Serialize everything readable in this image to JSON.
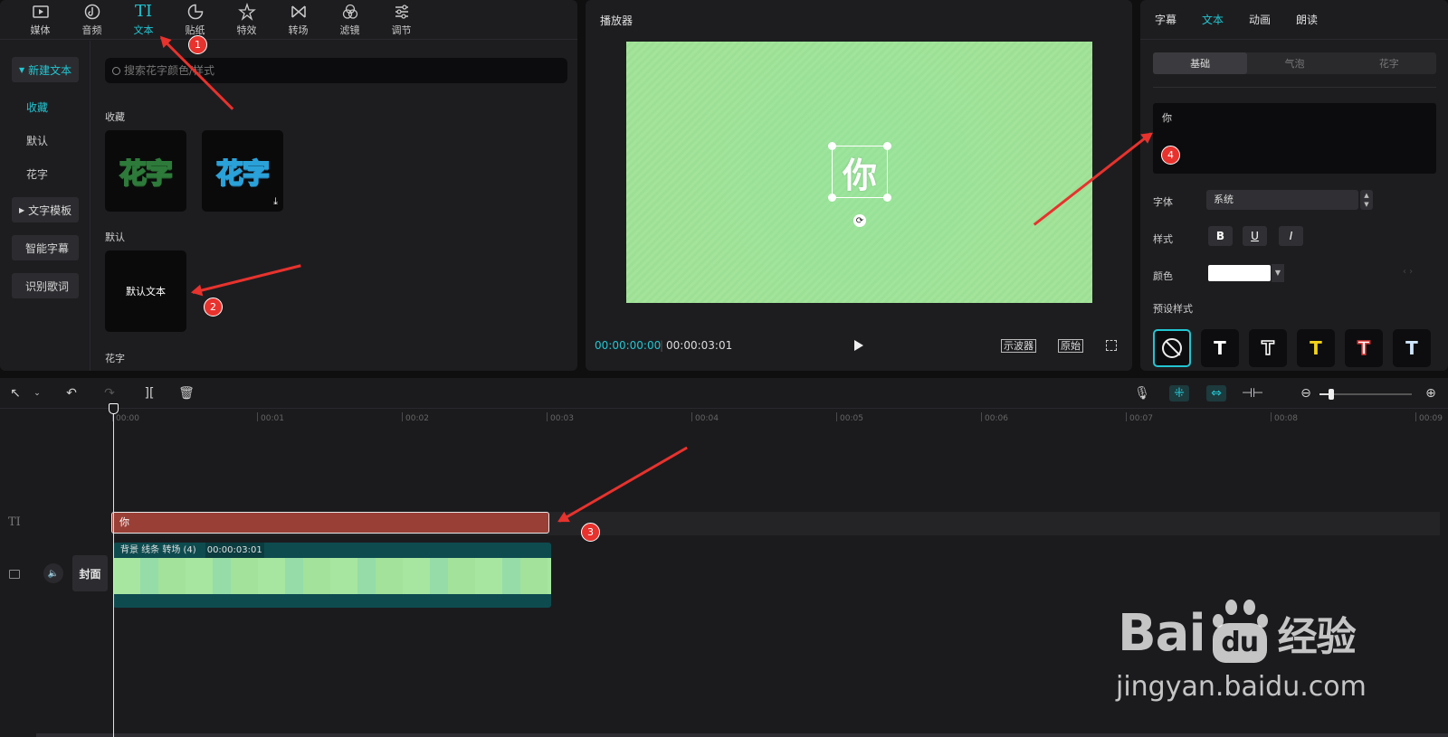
{
  "top_tools": [
    {
      "label": "媒体",
      "icon": "media-icon"
    },
    {
      "label": "音频",
      "icon": "audio-icon"
    },
    {
      "label": "文本",
      "icon": "text-icon",
      "active": true,
      "glyph": "TI"
    },
    {
      "label": "贴纸",
      "icon": "sticker-icon"
    },
    {
      "label": "特效",
      "icon": "effects-icon"
    },
    {
      "label": "转场",
      "icon": "transition-icon"
    },
    {
      "label": "滤镜",
      "icon": "filter-icon"
    },
    {
      "label": "调节",
      "icon": "adjust-icon"
    }
  ],
  "sidebar": {
    "new_text": "新建文本",
    "favorites": "收藏",
    "default": "默认",
    "fancy": "花字",
    "text_template": "文字模板",
    "smart_caption": "智能字幕",
    "lyrics": "识别歌词"
  },
  "search": {
    "placeholder": "搜索花字颜色/样式"
  },
  "library": {
    "favorites_label": "收藏",
    "fancy_tile_1": "花字",
    "fancy_tile_2": "花字",
    "default_label": "默认",
    "default_tile": "默认文本",
    "fancy_label": "花字"
  },
  "player": {
    "title": "播放器",
    "canvas_text": "你",
    "current_time": "00:00:00:00",
    "total_time": "00:00:03:01",
    "scope_btn": "示波器",
    "original_btn": "原始"
  },
  "right": {
    "tabs": [
      "字幕",
      "文本",
      "动画",
      "朗读"
    ],
    "active_tab": 1,
    "segments": [
      "基础",
      "气泡",
      "花字"
    ],
    "text_value": "你",
    "font_label": "字体",
    "font_value": "系统",
    "style_label": "样式",
    "style_buttons": [
      "B",
      "U",
      "I"
    ],
    "color_label": "颜色",
    "color_value": "#ffffff",
    "preset_label": "预设样式",
    "preset_glyph": "T"
  },
  "timeline": {
    "ruler": [
      "00:00",
      "00:01",
      "00:02",
      "00:03",
      "00:04",
      "00:05",
      "00:06",
      "00:07",
      "00:08",
      "00:09"
    ],
    "text_clip": "你",
    "text_track_icon": "TI",
    "video_clip_name": "背景 线条 转场 (4)",
    "video_clip_dur": "00:00:03:01",
    "cover_label": "封面"
  },
  "annotations": [
    "1",
    "2",
    "3",
    "4"
  ],
  "watermark": {
    "logo_a": "Bai",
    "logo_b": "du",
    "logo_c": "经验",
    "url": "jingyan.baidu.com"
  },
  "colors": {
    "accent": "#22c6d2",
    "text_clip": "#9a3f36",
    "video_clip": "#0e4b4f",
    "annotation": "#e8322d"
  }
}
